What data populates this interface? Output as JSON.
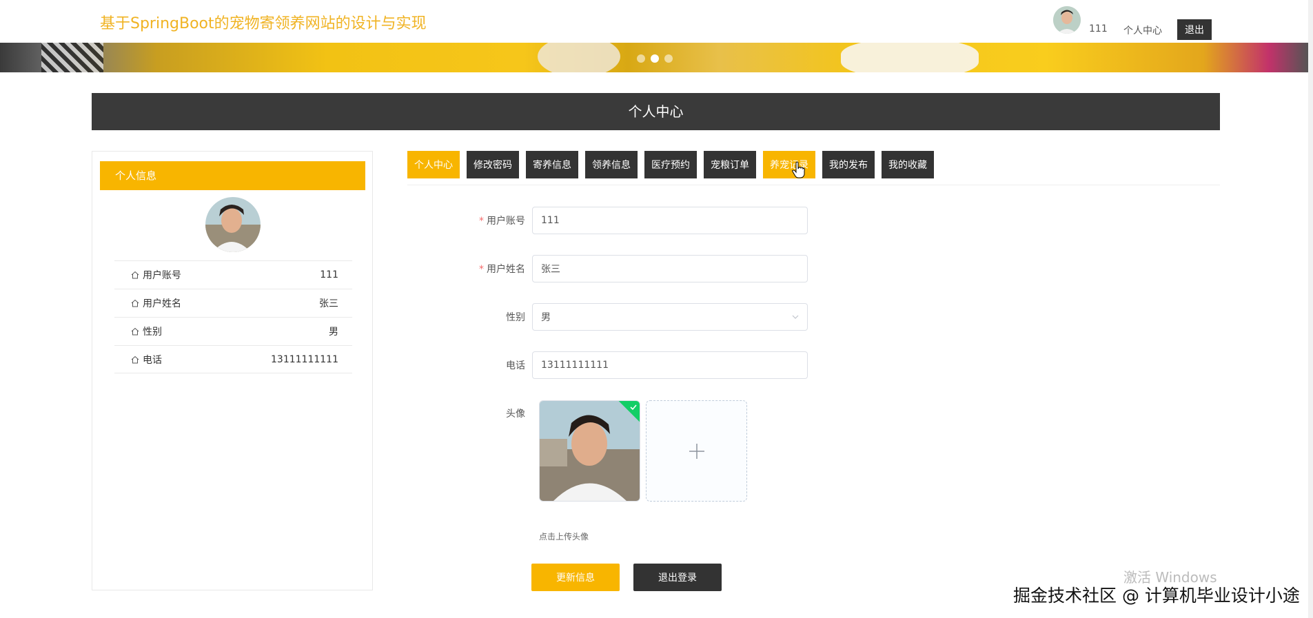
{
  "header": {
    "site_title": "基于SpringBoot的宠物寄领养网站的设计与实现",
    "username": "111",
    "personal_center": "个人中心",
    "logout": "退出"
  },
  "banner": {
    "slides": 3,
    "active_slide": 2
  },
  "section_title": "个人中心",
  "left_panel": {
    "title": "个人信息",
    "rows": [
      {
        "label": "用户账号",
        "value": "111"
      },
      {
        "label": "用户姓名",
        "value": "张三"
      },
      {
        "label": "性别",
        "value": "男"
      },
      {
        "label": "电话",
        "value": "13111111111"
      }
    ]
  },
  "tabs": [
    "个人中心",
    "修改密码",
    "寄养信息",
    "领养信息",
    "医疗预约",
    "宠粮订单",
    "养宠记录",
    "我的发布",
    "我的收藏"
  ],
  "active_tab": 0,
  "hover_tab": 6,
  "form": {
    "account_label": "用户账号",
    "account_value": "111",
    "name_label": "用户姓名",
    "name_value": "张三",
    "gender_label": "性别",
    "gender_value": "男",
    "phone_label": "电话",
    "phone_value": "13111111111",
    "avatar_label": "头像",
    "upload_hint": "点击上传头像",
    "update_button": "更新信息",
    "logout_button": "退出登录"
  },
  "watermark": {
    "windows": "激活 Windows",
    "community": "掘金技术社区 @ 计算机毕业设计小途"
  },
  "colors": {
    "accent": "#f8b500",
    "dark": "#333333",
    "success": "#13ce66"
  }
}
